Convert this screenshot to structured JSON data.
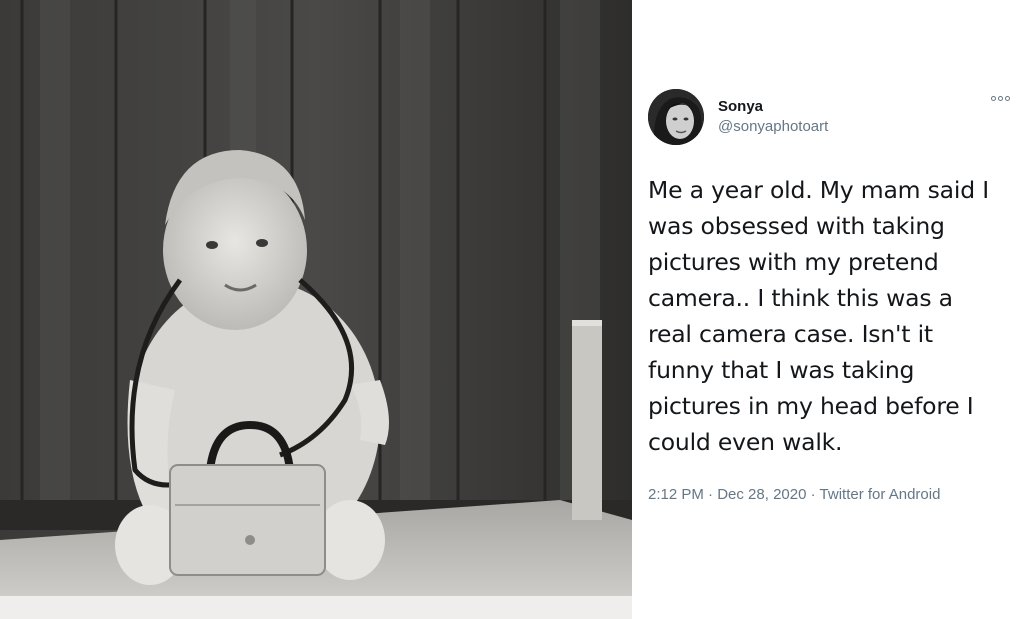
{
  "photo": {
    "alt": "black and white photograph of a baby holding a camera case"
  },
  "tweet": {
    "display_name": "Sonya",
    "handle": "@sonyaphotoart",
    "more_icon": "more-options-icon",
    "text": "Me a year old. My mam said I was obsessed with taking pictures with my pretend camera.. I think this was a real camera case. Isn't it funny that I was taking pictures in my head before I could even walk.",
    "time": "2:12 PM",
    "date": "Dec 28, 2020",
    "source": "Twitter for Android",
    "separator": "·"
  },
  "colors": {
    "text_primary": "#14171a",
    "text_secondary": "#657786",
    "background": "#ffffff"
  }
}
